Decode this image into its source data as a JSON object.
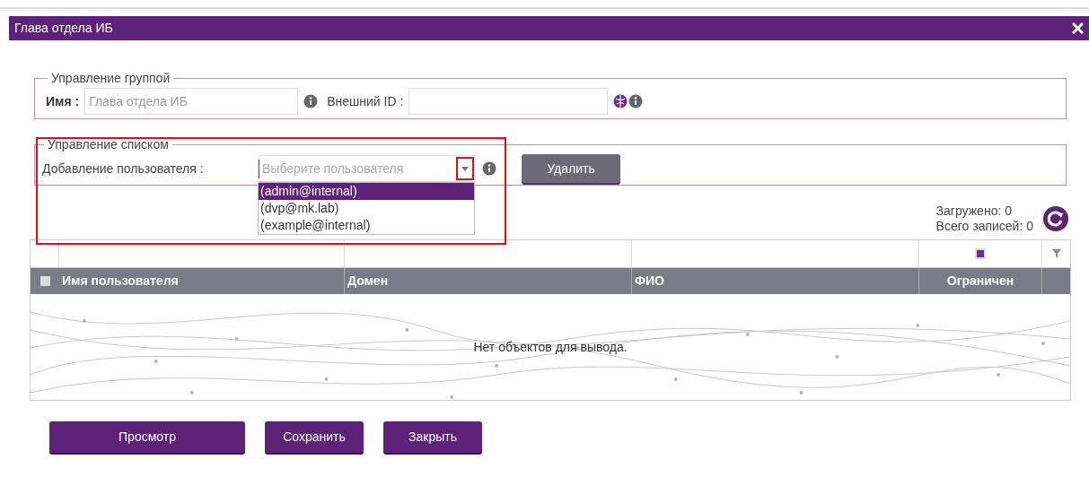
{
  "dialog": {
    "title": "Глава отдела ИБ"
  },
  "group_management": {
    "legend": "Управление группой",
    "name_label": "Имя :",
    "name_value": "Глава отдела ИБ",
    "external_id_label": "Внешний ID :"
  },
  "list_management": {
    "legend": "Управление списком",
    "highlighted": true,
    "add_user_label": "Добавление пользователя :",
    "user_select": {
      "placeholder": "Выберите пользователя",
      "expanded": true,
      "arrow_highlighted": true,
      "options": [
        {
          "label": "(admin@internal)",
          "selected": true
        },
        {
          "label": "(dvp@mk.lab)",
          "selected": false
        },
        {
          "label": "(example@internal)",
          "selected": false
        }
      ]
    },
    "delete_button": "Удалить"
  },
  "counters": {
    "loaded": "Загружено: 0",
    "total": "Всего записей: 0"
  },
  "table": {
    "select_all_checked": false,
    "restricted_filter_checked": true,
    "columns": [
      {
        "label": "Имя пользователя"
      },
      {
        "label": "Домен"
      },
      {
        "label": "ФИО"
      },
      {
        "label": "Ограничен"
      }
    ],
    "empty_message": "Нет объектов для вывода."
  },
  "buttons": [
    "Просмотр",
    "Сохранить",
    "Закрыть"
  ]
}
